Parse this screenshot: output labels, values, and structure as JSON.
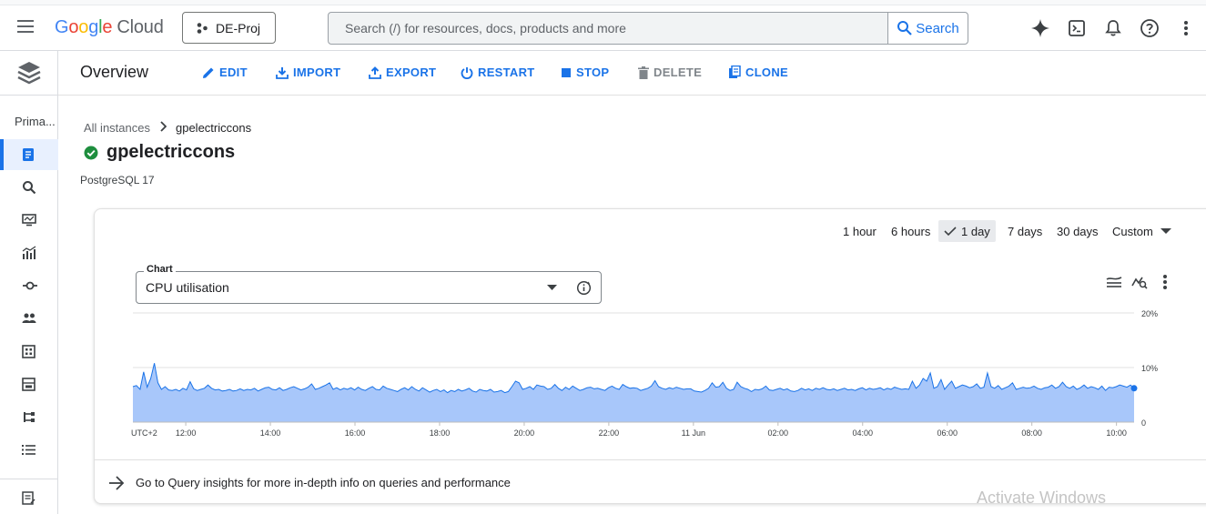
{
  "header": {
    "logo_google": "Google",
    "logo_cloud": "Cloud",
    "project": "DE-Proj",
    "search_placeholder": "Search (/) for resources, docs, products and more",
    "search_button": "Search"
  },
  "rail": {
    "section_label": "Prima..."
  },
  "actionbar": {
    "title": "Overview",
    "actions": {
      "edit": "EDIT",
      "import": "IMPORT",
      "export": "EXPORT",
      "restart": "RESTART",
      "stop": "STOP",
      "delete": "DELETE",
      "clone": "CLONE"
    }
  },
  "breadcrumb": {
    "parent": "All instances",
    "current": "gpelectriccons"
  },
  "instance": {
    "name": "gpelectriccons",
    "status": "running",
    "engine": "PostgreSQL 17"
  },
  "time_ranges": {
    "r1": "1 hour",
    "r2": "6 hours",
    "r3": "1 day",
    "r4": "7 days",
    "r5": "30 days",
    "r6": "Custom",
    "selected": "1 day"
  },
  "chart_select": {
    "label": "Chart",
    "value": "CPU utilisation"
  },
  "footer_link": "Go to Query insights for more in-depth info on queries and performance",
  "watermark": "Activate Windows",
  "colors": {
    "accent": "#1a73e8",
    "status_green": "#1e8e3e",
    "area_fill": "#a8c7fa",
    "area_line": "#1a73e8"
  },
  "chart_data": {
    "type": "area",
    "title": "CPU utilisation",
    "ylim": [
      0,
      20
    ],
    "y_ticks": [
      "20%",
      "10%",
      "0"
    ],
    "y_tick_values": [
      20,
      10,
      0
    ],
    "x_tick_labels": [
      "UTC+2",
      "12:00",
      "14:00",
      "16:00",
      "18:00",
      "20:00",
      "22:00",
      "11 Jun",
      "02:00",
      "04:00",
      "06:00",
      "08:00",
      "10:00"
    ],
    "x_start": "10:45",
    "x_end": "10:25",
    "grid": true,
    "series": [
      {
        "values": [
          6.5,
          6.7,
          6.0,
          9.2,
          6.4,
          8.0,
          10.8,
          7.2,
          6.0,
          6.5,
          5.9,
          5.8,
          6.0,
          5.7,
          6.2,
          5.9,
          7.4,
          6.1,
          5.8,
          6.0,
          6.2,
          6.8,
          6.2,
          5.9,
          6.0,
          5.7,
          5.8,
          6.0,
          5.7,
          5.8,
          6.1,
          5.8,
          6.0,
          5.9,
          6.2,
          5.7,
          6.0,
          6.3,
          6.4,
          6.0,
          5.9,
          6.3,
          5.8,
          6.0,
          6.3,
          6.5,
          6.2,
          5.9,
          6.1,
          6.4,
          7.0,
          6.0,
          6.2,
          6.5,
          6.8,
          7.2,
          6.0,
          6.3,
          5.9,
          6.2,
          6.0,
          6.3,
          5.9,
          6.4,
          6.0,
          5.8,
          6.2,
          6.5,
          6.0,
          5.9,
          6.6,
          6.2,
          6.0,
          5.8,
          5.6,
          6.0,
          6.3,
          5.9,
          6.5,
          6.0,
          5.7,
          6.3,
          5.9,
          5.5,
          5.8,
          6.0,
          5.6,
          5.9,
          5.4,
          5.8,
          5.6,
          6.0,
          5.7,
          5.9,
          6.2,
          5.7,
          5.5,
          6.0,
          5.8,
          5.7,
          6.0,
          5.5,
          5.6,
          5.8,
          5.4,
          5.6,
          6.5,
          7.5,
          7.2,
          6.0,
          6.2,
          6.5,
          6.0,
          6.8,
          6.6,
          6.5,
          6.0,
          6.2,
          6.9,
          6.2,
          5.8,
          6.4,
          6.0,
          6.6,
          6.2,
          5.8,
          6.0,
          6.3,
          6.4,
          6.1,
          6.2,
          6.0,
          5.8,
          6.3,
          6.6,
          6.2,
          6.0,
          6.9,
          6.5,
          6.2,
          6.3,
          6.2,
          5.8,
          6.0,
          6.2,
          6.6,
          7.6,
          6.5,
          6.2,
          6.0,
          6.3,
          6.1,
          6.4,
          6.2,
          6.0,
          6.1,
          6.1,
          5.7,
          5.6,
          5.5,
          5.8,
          6.2,
          7.2,
          6.4,
          6.5,
          7.3,
          6.2,
          5.8,
          6.0,
          7.3,
          6.5,
          6.2,
          6.0,
          5.6,
          6.0,
          5.9,
          6.1,
          6.6,
          5.9,
          5.8,
          6.0,
          6.2,
          5.9,
          6.1,
          5.7,
          5.6,
          5.8,
          6.2,
          5.9,
          6.1,
          5.8,
          6.2,
          6.0,
          6.3,
          6.0,
          5.9,
          6.1,
          5.8,
          6.0,
          6.2,
          5.9,
          6.0,
          5.8,
          6.1,
          6.3,
          5.9,
          6.2,
          6.0,
          6.1,
          6.3,
          5.9,
          6.2,
          6.0,
          6.4,
          6.2,
          6.0,
          6.1,
          6.0,
          7.5,
          6.2,
          6.8,
          8.0,
          7.5,
          9.0,
          6.2,
          6.5,
          7.8,
          6.0,
          6.8,
          7.5,
          6.2,
          6.5,
          6.8,
          6.6,
          6.3,
          6.5,
          7.0,
          6.2,
          6.4,
          9.0,
          6.5,
          6.2,
          6.7,
          6.0,
          6.3,
          6.6,
          7.2,
          6.0,
          6.2,
          6.4,
          6.2,
          6.3,
          6.6,
          6.2,
          6.0,
          6.3,
          6.4,
          6.8,
          6.2,
          6.5,
          7.3,
          6.5,
          6.2,
          6.6,
          6.0,
          6.3,
          6.8,
          6.2,
          6.5,
          6.3,
          6.0,
          6.6,
          5.8,
          6.4,
          6.3,
          6.5,
          6.8,
          6.6,
          6.4,
          6.8,
          6.2
        ]
      }
    ]
  }
}
